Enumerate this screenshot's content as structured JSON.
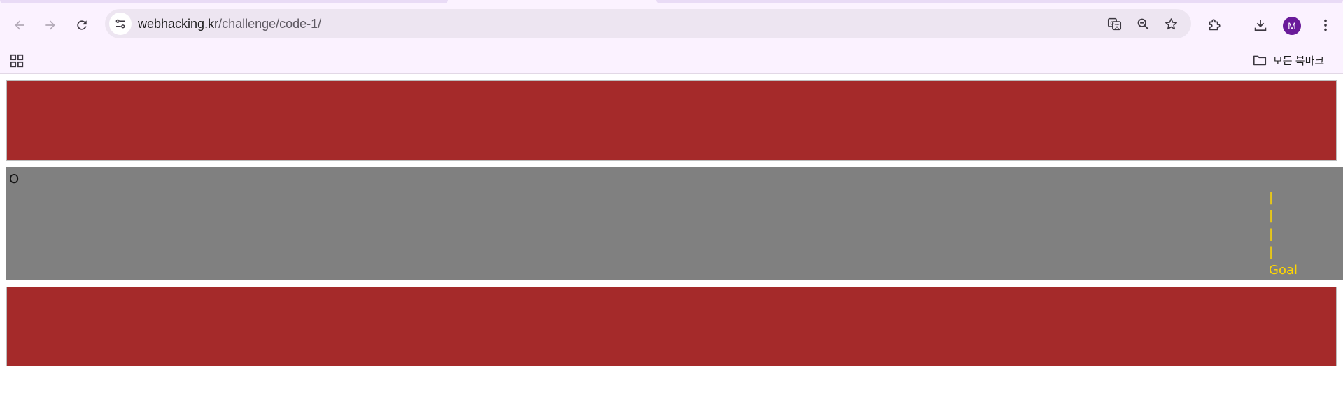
{
  "browser": {
    "url_host": "webhacking.kr",
    "url_path": "/challenge/code-1/",
    "profile_initial": "M",
    "bookmarks_label": "모든 북마크"
  },
  "icons": {
    "back": "back-arrow-icon",
    "forward": "forward-arrow-icon",
    "reload": "reload-icon",
    "site_info": "tune-icon",
    "translate": "translate-icon",
    "zoom": "zoom-out-icon",
    "bookmark_star": "star-icon",
    "extensions": "puzzle-icon",
    "downloads": "download-icon",
    "menu": "kebab-menu-icon",
    "apps": "apps-grid-icon",
    "folder": "folder-icon"
  },
  "page": {
    "player_marker": "O",
    "goal_marks": [
      "|",
      "|",
      "|",
      "|"
    ],
    "goal_label": "Goal"
  },
  "colors": {
    "wall": "#a52a2a",
    "track": "#808080",
    "goal": "#ffd700",
    "avatar": "#6a1b9a"
  }
}
